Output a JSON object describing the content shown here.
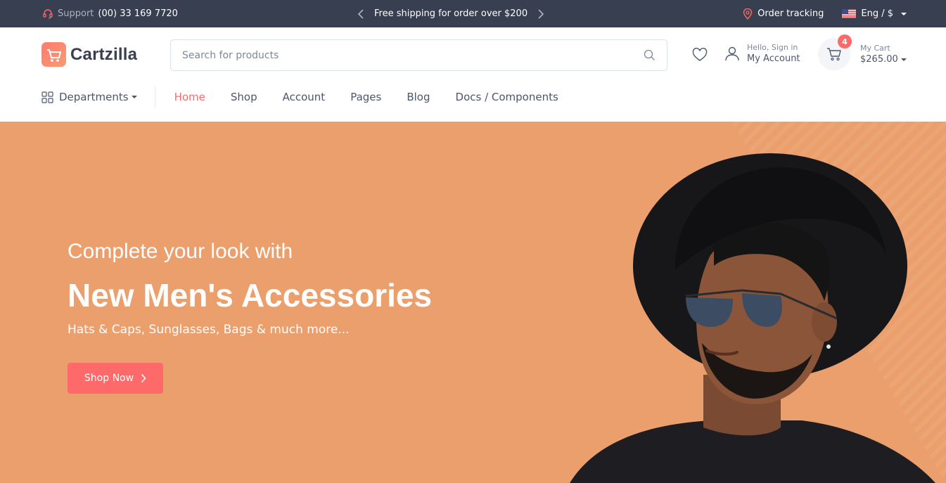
{
  "topbar": {
    "support_label": "Support",
    "support_phone": "(00) 33 169 7720",
    "promo_text": "Free shipping for order over $200",
    "order_tracking": "Order tracking",
    "language": "Eng / $"
  },
  "header": {
    "logo_text": "Cartzilla",
    "search_placeholder": "Search for products",
    "account_small": "Hello, Sign in",
    "account_big": "My Account",
    "cart_count": "4",
    "cart_small": "My Cart",
    "cart_total": "$265.00"
  },
  "nav": {
    "departments": "Departments",
    "links": [
      {
        "label": "Home",
        "active": true
      },
      {
        "label": "Shop"
      },
      {
        "label": "Account"
      },
      {
        "label": "Pages"
      },
      {
        "label": "Blog"
      },
      {
        "label": "Docs / Components"
      }
    ]
  },
  "hero": {
    "pretitle": "Complete your look with",
    "title": "New Men's Accessories",
    "subtitle": "Hats & Caps, Sunglasses, Bags & much more...",
    "button_label": "Shop Now"
  },
  "colors": {
    "accent": "#fe696a",
    "topbar": "#373f50",
    "hero_bg": "#eb9f6c"
  }
}
